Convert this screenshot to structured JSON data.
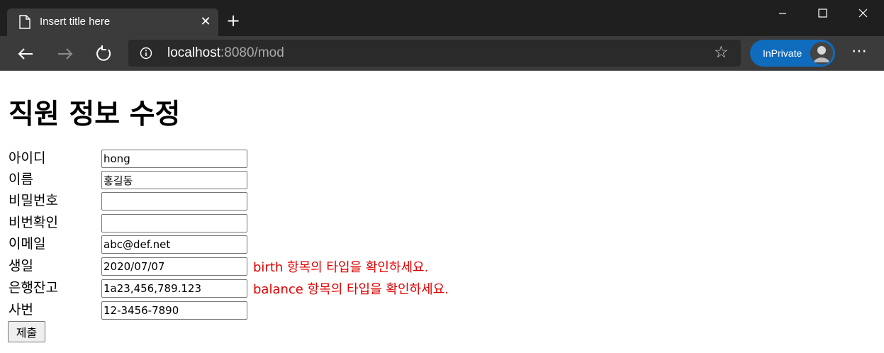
{
  "browser": {
    "tab_title": "Insert title here",
    "url_host": "localhost",
    "url_rest": ":8080/mod",
    "profile_label": "InPrivate",
    "icons": {
      "page": "page-icon",
      "close": "close-icon",
      "new_tab": "plus-icon",
      "back": "arrow-left-icon",
      "forward": "arrow-right-icon",
      "refresh": "refresh-icon",
      "info": "info-icon",
      "favorite": "star-icon",
      "more": "more-icon"
    }
  },
  "page": {
    "title": "직원 정보 수정",
    "fields": [
      {
        "label": "아이디",
        "value": "hong",
        "error": ""
      },
      {
        "label": "이름",
        "value": "홍길동",
        "error": ""
      },
      {
        "label": "비밀번호",
        "value": "",
        "error": ""
      },
      {
        "label": "비번확인",
        "value": "",
        "error": ""
      },
      {
        "label": "이메일",
        "value": "abc@def.net",
        "error": ""
      },
      {
        "label": "생일",
        "value": "2020/07/07",
        "error": "birth 항목의 타입을 확인하세요."
      },
      {
        "label": "은행잔고",
        "value": "1a23,456,789.123",
        "error": "balance 항목의 타입을 확인하세요."
      },
      {
        "label": "사번",
        "value": "12-3456-7890",
        "error": ""
      }
    ],
    "submit_label": "제출",
    "error_color": "#e00000"
  }
}
